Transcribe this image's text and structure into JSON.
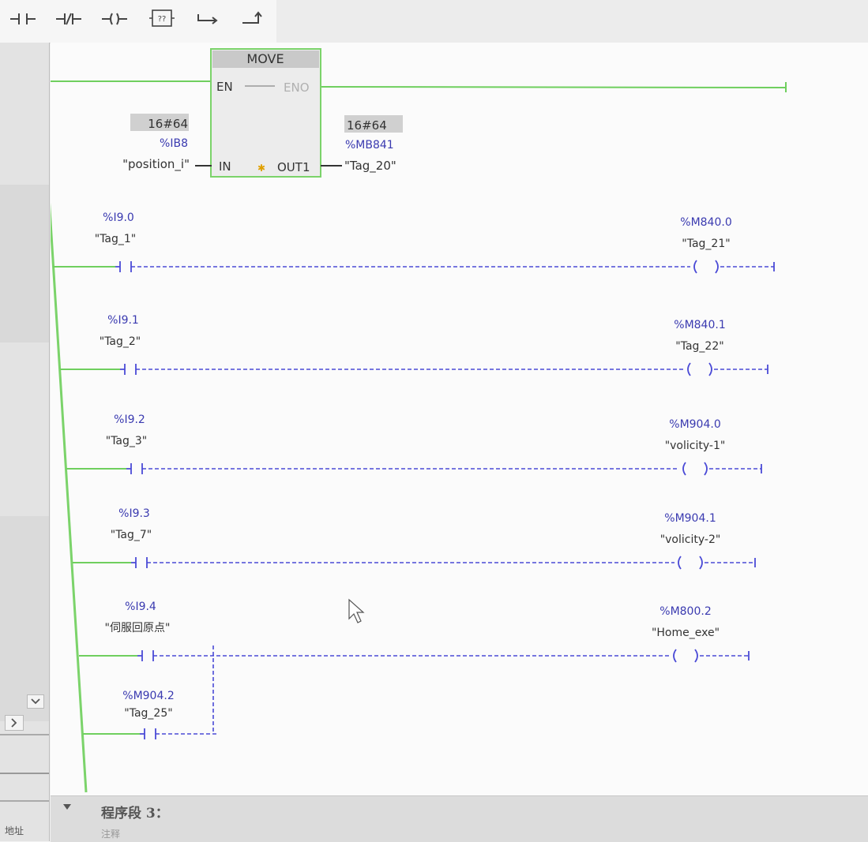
{
  "toolbar": {
    "buttons": [
      {
        "name": "no-contact-icon"
      },
      {
        "name": "nc-contact-icon"
      },
      {
        "name": "coil-icon"
      },
      {
        "name": "empty-box-icon",
        "label": "??"
      },
      {
        "name": "open-branch-icon"
      },
      {
        "name": "close-branch-icon"
      }
    ]
  },
  "move_block": {
    "title": "MOVE",
    "en": "EN",
    "eno": "ENO",
    "in_pin": "IN",
    "out_pin": "OUT1",
    "in_value": "16#64",
    "in_address": "%IB8",
    "in_tag": "\"position_i\"",
    "out_value": "16#64",
    "out_address": "%MB841",
    "out_tag": "\"Tag_20\""
  },
  "rungs": [
    {
      "contact_address": "%I9.0",
      "contact_tag": "\"Tag_1\"",
      "coil_address": "%M840.0",
      "coil_tag": "\"Tag_21\""
    },
    {
      "contact_address": "%I9.1",
      "contact_tag": "\"Tag_2\"",
      "coil_address": "%M840.1",
      "coil_tag": "\"Tag_22\""
    },
    {
      "contact_address": "%I9.2",
      "contact_tag": "\"Tag_3\"",
      "coil_address": "%M904.0",
      "coil_tag": "\"volicity-1\""
    },
    {
      "contact_address": "%I9.3",
      "contact_tag": "\"Tag_7\"",
      "coil_address": "%M904.1",
      "coil_tag": "\"volicity-2\""
    },
    {
      "contact_address": "%I9.4",
      "contact_tag": "\"伺服回原点\"",
      "coil_address": "%M800.2",
      "coil_tag": "\"Home_exe\""
    }
  ],
  "branch_contact": {
    "address": "%M904.2",
    "tag": "\"Tag_25\""
  },
  "footer": {
    "network_title": "程序段 3：",
    "comment": "注释",
    "address_label": "地址"
  },
  "colors": {
    "power_rail": "#7bd36a",
    "energized": "#6fcf5e",
    "unpowered": "#4a4ad6",
    "label": "#3a3ab0",
    "value_box": "#d0d0d0"
  }
}
